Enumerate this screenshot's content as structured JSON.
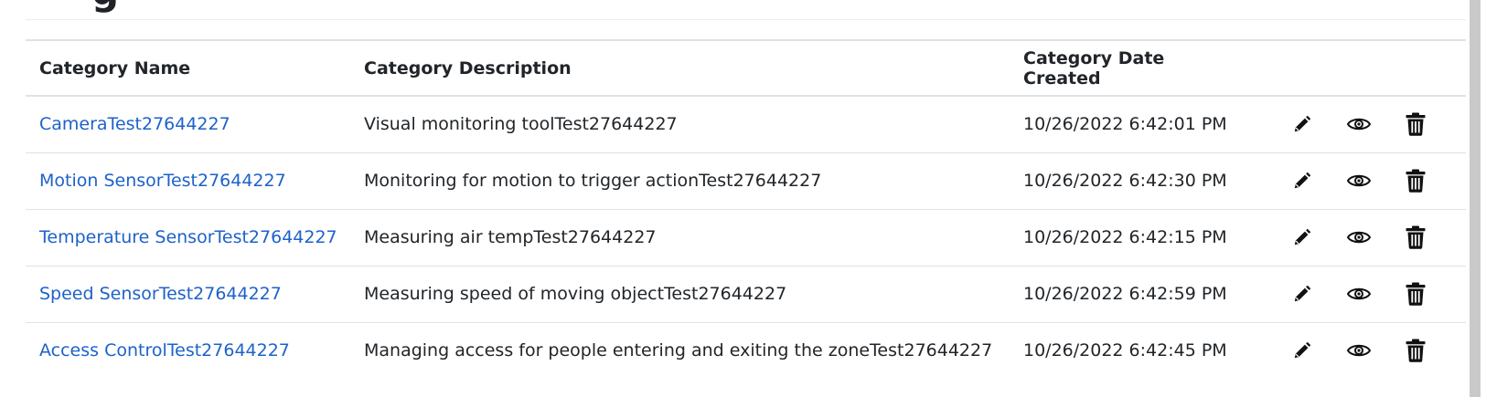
{
  "table": {
    "headers": [
      "Category Name",
      "Category Description",
      "Category Date Created",
      ""
    ],
    "rows": [
      {
        "name": "CameraTest27644227",
        "description": "Visual monitoring toolTest27644227",
        "date": "10/26/2022 6:42:01 PM"
      },
      {
        "name": "Motion SensorTest27644227",
        "description": "Monitoring for motion to trigger actionTest27644227",
        "date": "10/26/2022 6:42:30 PM"
      },
      {
        "name": "Temperature SensorTest27644227",
        "description": "Measuring air tempTest27644227",
        "date": "10/26/2022 6:42:15 PM"
      },
      {
        "name": "Speed SensorTest27644227",
        "description": "Measuring speed of moving objectTest27644227",
        "date": "10/26/2022 6:42:59 PM"
      },
      {
        "name": "Access ControlTest27644227",
        "description": "Managing access for people entering and exiting the zoneTest27644227",
        "date": "10/26/2022 6:42:45 PM"
      }
    ],
    "row_actions": [
      "edit-icon",
      "view-icon",
      "delete-icon"
    ]
  },
  "colors": {
    "link": "#1d62c9",
    "text": "#212529",
    "border": "#dee2e6"
  }
}
